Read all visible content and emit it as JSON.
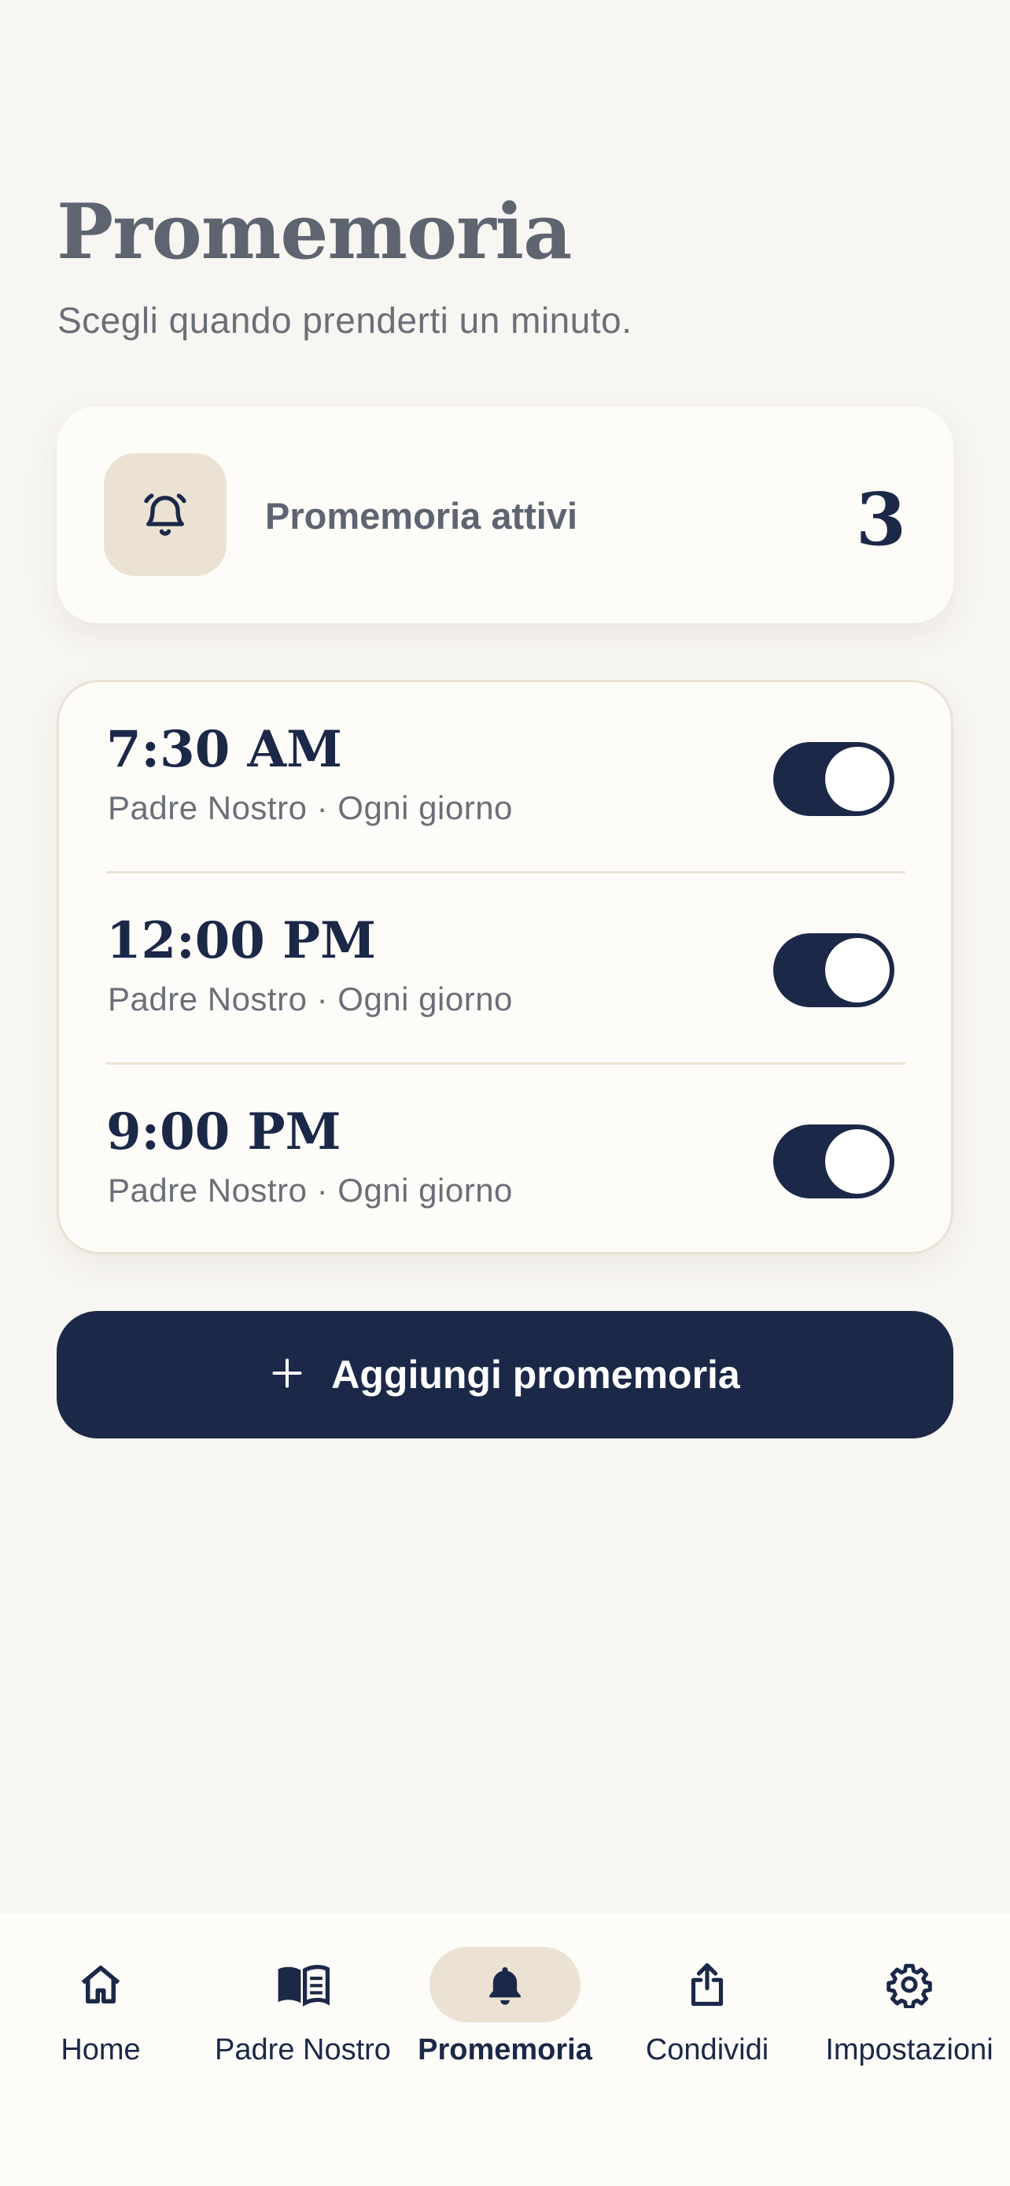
{
  "header": {
    "title": "Promemoria",
    "subtitle": "Scegli quando prenderti un minuto."
  },
  "summary": {
    "icon": "bell-ringing-icon",
    "label": "Promemoria attivi",
    "count": "3"
  },
  "reminders": [
    {
      "time": "7:30 AM",
      "detail": "Padre Nostro · Ogni giorno",
      "enabled": true
    },
    {
      "time": "12:00 PM",
      "detail": "Padre Nostro · Ogni giorno",
      "enabled": true
    },
    {
      "time": "9:00 PM",
      "detail": "Padre Nostro · Ogni giorno",
      "enabled": true
    }
  ],
  "add_button": {
    "icon": "plus-icon",
    "label": "Aggiungi promemoria"
  },
  "tabbar": {
    "items": [
      {
        "label": "Home",
        "icon": "home-icon",
        "active": false
      },
      {
        "label": "Padre Nostro",
        "icon": "book-icon",
        "active": false
      },
      {
        "label": "Promemoria",
        "icon": "bell-icon",
        "active": true
      },
      {
        "label": "Condividi",
        "icon": "share-icon",
        "active": false
      },
      {
        "label": "Impostazioni",
        "icon": "gear-icon",
        "active": false
      }
    ]
  },
  "colors": {
    "background": "#f8f6f2",
    "navy": "#1c2848",
    "beige_accent": "#ebe2d3",
    "card": "#fdfcf9"
  }
}
